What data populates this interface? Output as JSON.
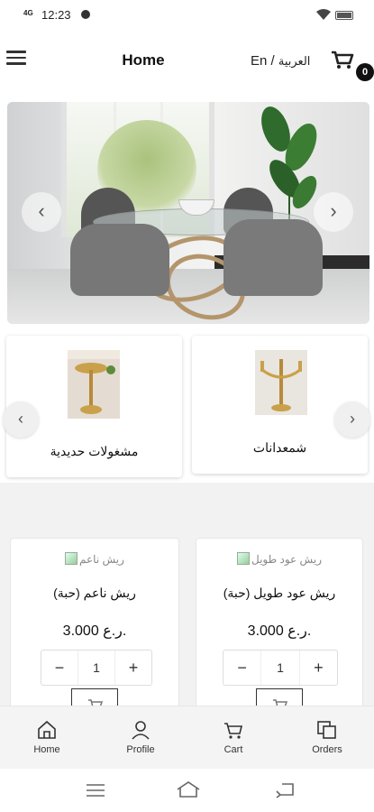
{
  "status_bar": {
    "time": "12:23",
    "network": "4G"
  },
  "header": {
    "title": "Home",
    "language_en": "En",
    "language_separator": "/",
    "language_ar": "العربية",
    "cart_count": "0"
  },
  "hero": {
    "icons": {
      "prev": "chevron-left-icon",
      "next": "chevron-right-icon"
    }
  },
  "categories": [
    {
      "label": "مشغولات حديدية"
    },
    {
      "label": "شمعدانات"
    }
  ],
  "products": [
    {
      "image_alt": "ريش ناعم",
      "name": "ريش ناعم (حبة)",
      "price": "3.000 ر.ع.",
      "quantity": "1"
    },
    {
      "image_alt": "ريش عود طويل",
      "name": "ريش عود طويل (حبة)",
      "price": "3.000 ر.ع.",
      "quantity": "1"
    }
  ],
  "stepper": {
    "minus": "−",
    "plus": "+"
  },
  "bottom_nav": [
    {
      "label": "Home",
      "icon": "home-icon"
    },
    {
      "label": "Profile",
      "icon": "profile-icon"
    },
    {
      "label": "Cart",
      "icon": "cart-icon"
    },
    {
      "label": "Orders",
      "icon": "orders-icon"
    }
  ],
  "colors": {
    "accent": "#111111",
    "bar_bg": "#f4f4f4",
    "section_bg": "#f2f2f2"
  }
}
